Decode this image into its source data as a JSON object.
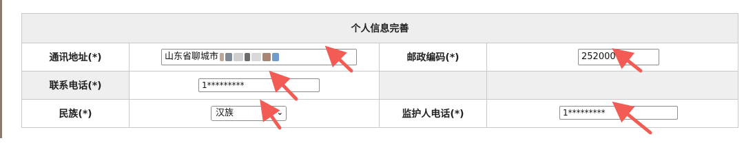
{
  "form": {
    "title": "个人信息完善",
    "address_label": "通讯地址(*)",
    "address_value": "山东省聊城市",
    "postcode_label": "邮政编码(*)",
    "postcode_value": "252000",
    "phone_label": "联系电话(*)",
    "phone_value": "1*********",
    "ethnicity_label": "民族(*)",
    "ethnicity_value": "汉族",
    "guardian_phone_label": "监护人电话(*)",
    "guardian_phone_value": "1*********"
  },
  "icons": {
    "dropdown": "chevron-down-icon",
    "annotation": "red-arrow-icon"
  },
  "colors": {
    "arrow": "#f25c54",
    "header_bg": "#eeeeee",
    "border": "#c8c8c8"
  }
}
